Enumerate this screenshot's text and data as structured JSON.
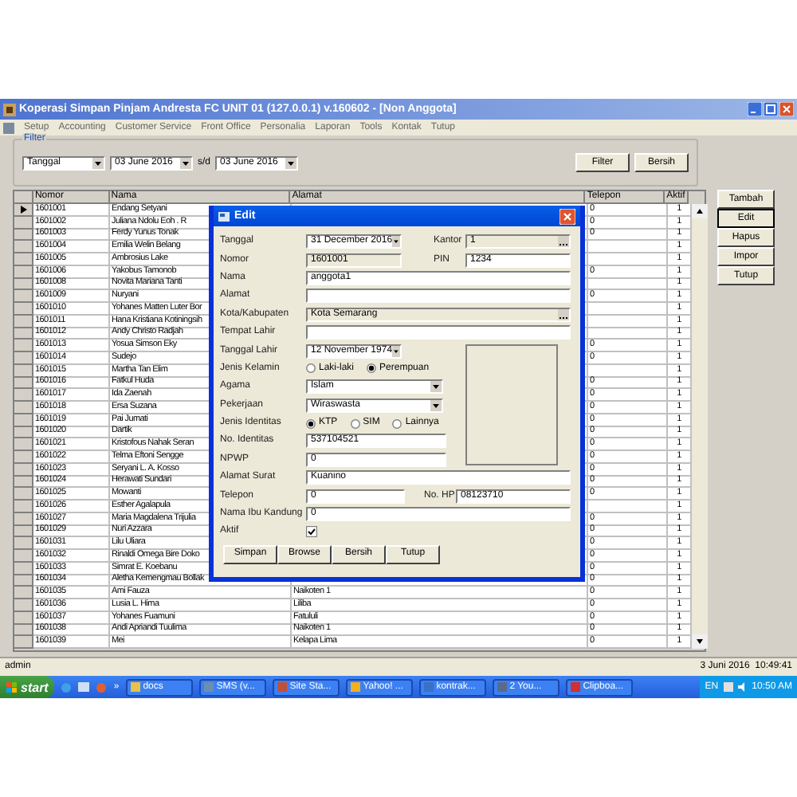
{
  "window": {
    "title": "Koperasi Simpan Pinjam Andresta FC UNIT 01 (127.0.0.1) v.160602 - [Non Anggota]"
  },
  "menu": [
    "Setup",
    "Accounting",
    "Customer Service",
    "Front Office",
    "Personalia",
    "Laporan",
    "Tools",
    "Kontak",
    "Tutup"
  ],
  "filter": {
    "label": "Filter",
    "field": "Tanggal",
    "from": "03 June 2016",
    "separator": "s/d",
    "to": "03 June 2016",
    "buttons": [
      "Filter",
      "Bersih"
    ]
  },
  "table": {
    "columns": [
      "Nomor",
      "Nama",
      "Alamat",
      "Telepon",
      "Aktif"
    ],
    "rows": [
      {
        "nomor": "1601001",
        "nama": "Endang Setyani",
        "telepon": "0",
        "aktif": "1",
        "selected": true
      },
      {
        "nomor": "1601002",
        "nama": "Juliana Ndolu Eoh . R",
        "telepon": "0",
        "aktif": "1",
        "selected": false
      },
      {
        "nomor": "1601003",
        "nama": "Ferdy Yunus Tonak",
        "telepon": "0",
        "aktif": "1",
        "selected": false
      },
      {
        "nomor": "1601004",
        "nama": "Emilia Welin Belang",
        "aktif": "1",
        "selected": false
      },
      {
        "nomor": "1601005",
        "nama": "Ambrosius Lake",
        "aktif": "1",
        "selected": false
      },
      {
        "nomor": "1601006",
        "nama": "Yakobus Tamonob",
        "telepon": "0",
        "aktif": "1",
        "selected": false
      },
      {
        "nomor": "1601008",
        "nama": "Novita Mariana Tanti",
        "aktif": "1",
        "selected": false
      },
      {
        "nomor": "1601009",
        "nama": "Nuryani",
        "telepon": "0",
        "aktif": "1",
        "selected": false
      },
      {
        "nomor": "1601010",
        "nama": "Yohanes Matten Luter Bor",
        "aktif": "1",
        "selected": false
      },
      {
        "nomor": "1601011",
        "nama": "Hana Kristiana Kotiningsih",
        "aktif": "1",
        "selected": false
      },
      {
        "nomor": "1601012",
        "nama": "Andy Christo Radjah",
        "aktif": "1",
        "selected": false
      },
      {
        "nomor": "1601013",
        "nama": "Yosua Simson Eky",
        "telepon": "0",
        "aktif": "1",
        "selected": false
      },
      {
        "nomor": "1601014",
        "nama": "Sudejo",
        "telepon": "0",
        "aktif": "1",
        "selected": false
      },
      {
        "nomor": "1601015",
        "nama": "Martha Tan Elim",
        "aktif": "1",
        "selected": false
      },
      {
        "nomor": "1601016",
        "nama": "Fatkul Huda",
        "telepon": "0",
        "aktif": "1",
        "selected": false
      },
      {
        "nomor": "1601017",
        "nama": "Ida Zaenah",
        "telepon": "0",
        "aktif": "1",
        "selected": false
      },
      {
        "nomor": "1601018",
        "nama": "Ersa Suzana",
        "telepon": "0",
        "aktif": "1",
        "selected": false
      },
      {
        "nomor": "1601019",
        "nama": "Pai Jumati",
        "telepon": "0",
        "aktif": "1",
        "selected": false
      },
      {
        "nomor": "1601020",
        "nama": "Dartik",
        "telepon": "0",
        "aktif": "1",
        "selected": false
      },
      {
        "nomor": "1601021",
        "nama": "Kristofous Nahak Seran",
        "telepon": "0",
        "aktif": "1",
        "selected": false
      },
      {
        "nomor": "1601022",
        "nama": "Telma Eftoni Sengge",
        "telepon": "0",
        "aktif": "1",
        "selected": false
      },
      {
        "nomor": "1601023",
        "nama": "Seryani L. A. Kosso",
        "telepon": "0",
        "aktif": "1",
        "selected": false
      },
      {
        "nomor": "1601024",
        "nama": "Herawati Sundari",
        "telepon": "0",
        "aktif": "1",
        "selected": false
      },
      {
        "nomor": "1601025",
        "nama": "Mowanti",
        "telepon": "0",
        "aktif": "1",
        "selected": false
      },
      {
        "nomor": "1601026",
        "nama": "Esther Agalapula",
        "aktif": "1",
        "selected": false
      },
      {
        "nomor": "1601027",
        "nama": "Maria Magdalena Trijulia",
        "telepon": "0",
        "aktif": "1",
        "selected": false
      },
      {
        "nomor": "1601029",
        "nama": "Nuri Azzara",
        "telepon": "0",
        "aktif": "1",
        "selected": false
      },
      {
        "nomor": "1601031",
        "nama": "Lilu Uliara",
        "telepon": "0",
        "aktif": "1",
        "selected": false
      },
      {
        "nomor": "1601032",
        "nama": "Rinaldi Omega Bire Doko",
        "telepon": "0",
        "aktif": "1",
        "selected": false
      },
      {
        "nomor": "1601033",
        "nama": "Simrat E. Koebanu",
        "telepon": "0",
        "aktif": "1",
        "selected": false
      },
      {
        "nomor": "1601034",
        "nama": "Aletha Kemengmau Bollak",
        "telepon": "0",
        "aktif": "1",
        "selected": false
      },
      {
        "nomor": "1601035",
        "nama": "Ami Fauza",
        "alamat": "Naikoten 1",
        "telepon": "0",
        "aktif": "1",
        "selected": false
      },
      {
        "nomor": "1601036",
        "nama": "Lusia L. Hima",
        "alamat": "Liliba",
        "telepon": "0",
        "aktif": "1",
        "selected": false
      },
      {
        "nomor": "1601037",
        "nama": "Yohanes Fuamuni",
        "alamat": "Fatululi",
        "telepon": "0",
        "aktif": "1",
        "selected": false
      },
      {
        "nomor": "1601038",
        "nama": "Andi Apriandi Tuulima",
        "alamat": "Naikoten 1",
        "telepon": "0",
        "aktif": "1",
        "selected": false
      },
      {
        "nomor": "1601039",
        "nama": "Mei",
        "alamat": "Kelapa Lima",
        "telepon": "0",
        "aktif": "1",
        "selected": false
      }
    ]
  },
  "side_buttons": [
    {
      "label": "Tambah",
      "focused": false
    },
    {
      "label": "Edit",
      "focused": true
    },
    {
      "label": "Hapus",
      "focused": false
    },
    {
      "label": "Impor",
      "focused": false
    },
    {
      "label": "Tutup",
      "focused": false
    }
  ],
  "dialog": {
    "title": "Edit",
    "tanggal": {
      "label": "Tanggal",
      "value": "31 December 2016"
    },
    "kantor": {
      "label": "Kantor",
      "value": "1"
    },
    "nomor": {
      "label": "Nomor",
      "value": "1601001"
    },
    "pin": {
      "label": "PIN",
      "value": "1234"
    },
    "nama": {
      "label": "Nama",
      "value": "anggota1"
    },
    "alamat": {
      "label": "Alamat"
    },
    "kota": {
      "label": "Kota/Kabupaten",
      "value": "Kota Semarang"
    },
    "tempat_lahir": {
      "label": "Tempat Lahir"
    },
    "tanggal_lahir": {
      "label": "Tanggal Lahir",
      "value": "12 November 1974"
    },
    "jenis_kelamin": {
      "label": "Jenis Kelamin",
      "options": [
        {
          "label": "Laki-laki",
          "selected": false
        },
        {
          "label": "Perempuan",
          "selected": true
        }
      ]
    },
    "agama": {
      "label": "Agama",
      "value": "Islam"
    },
    "pekerjaan": {
      "label": "Pekerjaan",
      "value": "Wiraswasta"
    },
    "jenis_identitas": {
      "label": "Jenis Identitas",
      "options": [
        {
          "label": "KTP",
          "selected": true
        },
        {
          "label": "SIM",
          "selected": false
        },
        {
          "label": "Lainnya",
          "selected": false
        }
      ]
    },
    "no_identitas": {
      "label": "No. Identitas",
      "value": "537104521"
    },
    "npwp": {
      "label": "NPWP",
      "value": "0"
    },
    "alamat_surat": {
      "label": "Alamat Surat",
      "value": "Kuanino"
    },
    "telepon": {
      "label": "Telepon",
      "value": "0"
    },
    "no_hp": {
      "label": "No. HP",
      "value": "08123710"
    },
    "nama_ibu": {
      "label": "Nama Ibu Kandung",
      "value": "0"
    },
    "aktif": {
      "label": "Aktif",
      "checked": true
    },
    "buttons": [
      "Simpan",
      "Browse",
      "Bersih",
      "Tutup"
    ]
  },
  "status_bar": {
    "user": "admin",
    "datetime": "3 Juni 2016  10:49:41"
  },
  "taskbar": {
    "start": "start",
    "more": "»",
    "tasks": [
      {
        "label": "docs",
        "color": "#e8c04a"
      },
      {
        "label": "SMS (v...",
        "color": "#6a8fb0"
      },
      {
        "label": "Site Sta...",
        "color": "#c0503a"
      },
      {
        "label": "Yahoo! ...",
        "color": "#f0b020"
      },
      {
        "label": "kontrak...",
        "color": "#3a70c8"
      },
      {
        "label": "2 You...",
        "color": "#5a6a8a"
      },
      {
        "label": "Clipboa...",
        "color": "#d03030"
      }
    ],
    "language": "EN",
    "time": "10:50 AM"
  }
}
